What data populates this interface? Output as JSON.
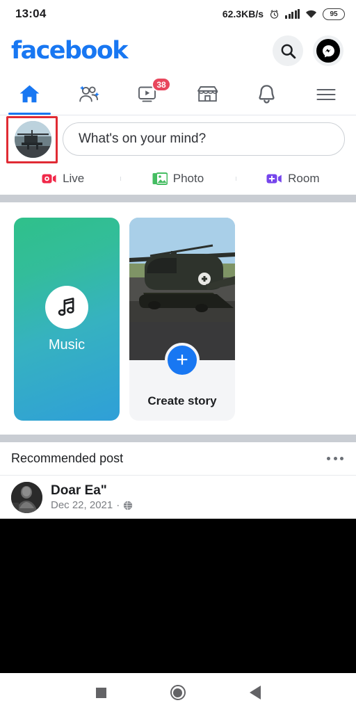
{
  "status_bar": {
    "time": "13:04",
    "network_speed": "62.3KB/s",
    "alarm_icon": "alarm-icon",
    "signal_icon": "signal-bars-icon",
    "wifi_icon": "wifi-icon",
    "battery_level": "95"
  },
  "header": {
    "logo": "facebook",
    "search_icon": "search-icon",
    "messenger_icon": "messenger-icon"
  },
  "tabs": [
    {
      "name": "home",
      "icon": "home-icon",
      "active": true,
      "badge": ""
    },
    {
      "name": "friends",
      "icon": "friends-icon",
      "active": false,
      "badge": ""
    },
    {
      "name": "watch",
      "icon": "video-play-icon",
      "active": false,
      "badge": "38"
    },
    {
      "name": "marketplace",
      "icon": "store-icon",
      "active": false,
      "badge": ""
    },
    {
      "name": "notifications",
      "icon": "bell-icon",
      "active": false,
      "badge": ""
    },
    {
      "name": "menu",
      "icon": "hamburger-menu-icon",
      "active": false,
      "badge": ""
    }
  ],
  "composer": {
    "avatar_icon": "user-avatar-helicopter",
    "placeholder": "What's on your mind?",
    "highlighted": true,
    "highlight_color": "#e02b34"
  },
  "composer_actions": [
    {
      "label": "Live",
      "icon": "live-video-icon",
      "color": "#f02849"
    },
    {
      "label": "Photo",
      "icon": "photo-icon",
      "color": "#45bd62"
    },
    {
      "label": "Room",
      "icon": "room-video-icon",
      "color": "#7646ec"
    }
  ],
  "stories": {
    "music_card": {
      "label": "Music",
      "icon": "music-note-icon",
      "gradient_start": "#2fc08a",
      "gradient_end": "#2f9fd8"
    },
    "create_card": {
      "label": "Create story",
      "plus_icon": "plus-icon",
      "plus_color": "#1877f2",
      "thumbnail": "helicopter-photo"
    }
  },
  "recommended": {
    "title": "Recommended post",
    "menu_icon": "more-options-icon"
  },
  "post": {
    "author": "Doar Ea\"",
    "date": "Dec 22, 2021",
    "separator": "·",
    "privacy_icon": "globe-icon",
    "avatar_icon": "post-author-avatar",
    "media_color": "#000000"
  },
  "navbar": {
    "recents_icon": "recents-square-icon",
    "home_icon": "home-circle-icon",
    "back_icon": "back-triangle-icon"
  },
  "colors": {
    "brand_blue": "#1877f2",
    "badge_red": "#e8465c",
    "divider_gray": "#c9cdd3"
  }
}
